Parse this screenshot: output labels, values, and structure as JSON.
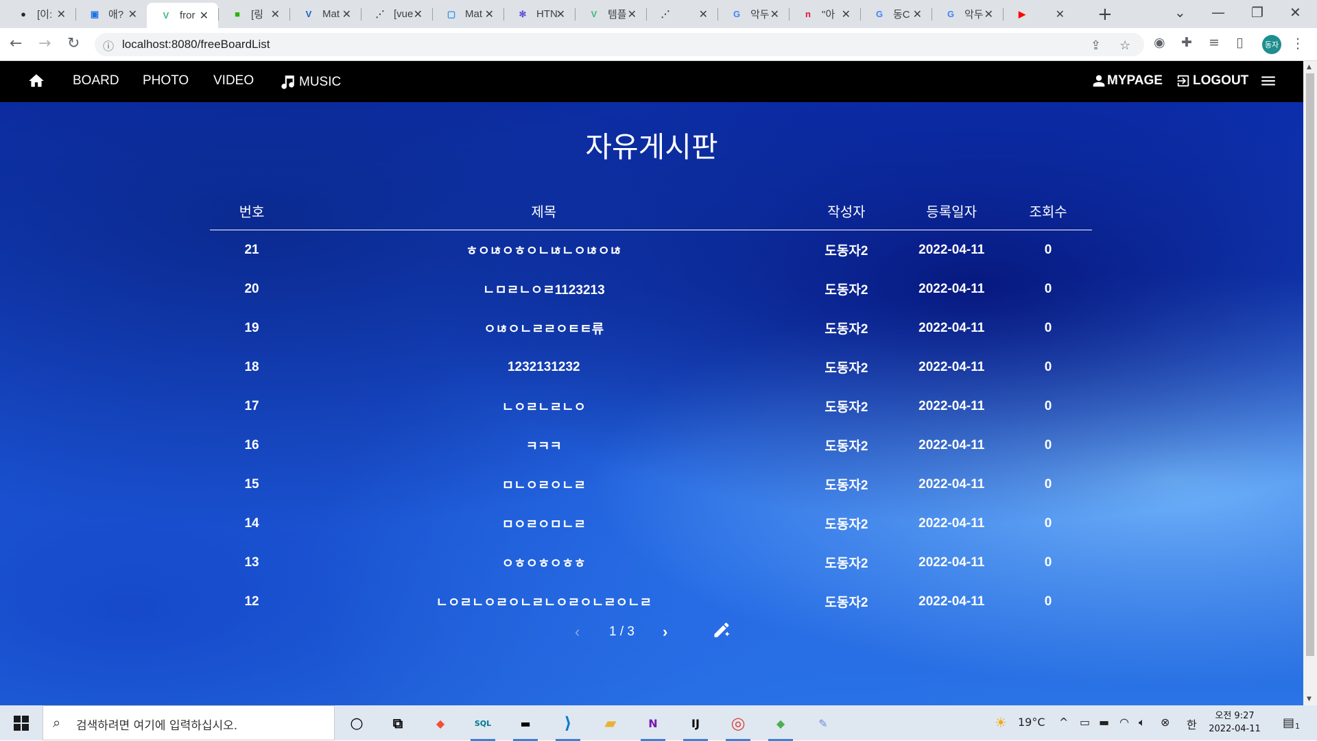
{
  "browser": {
    "tabs": [
      {
        "title": "[이:",
        "icon": "github-icon",
        "color": "#24292f"
      },
      {
        "title": "애?",
        "icon": "car-icon",
        "color": "#1a73e8"
      },
      {
        "title": "fror",
        "icon": "vue-icon",
        "color": "#41b883",
        "active": true
      },
      {
        "title": "[링",
        "icon": "green-square-icon",
        "color": "#2db400"
      },
      {
        "title": "Mat",
        "icon": "vuetify-icon",
        "color": "#1867c0"
      },
      {
        "title": "[vue",
        "icon": "dots-icon",
        "color": "#333333"
      },
      {
        "title": "Mat",
        "icon": "square-icon",
        "color": "#2196f3"
      },
      {
        "title": "HTN",
        "icon": "react-icon",
        "color": "#5b4fd6"
      },
      {
        "title": "템플",
        "icon": "vue-icon",
        "color": "#41b883"
      },
      {
        "title": "",
        "icon": "dots-icon",
        "color": "#333333"
      },
      {
        "title": "악두",
        "icon": "google-icon",
        "color": "#4285f4"
      },
      {
        "title": "\"아",
        "icon": "n-icon",
        "color": "#e8112d"
      },
      {
        "title": "동C",
        "icon": "google-icon",
        "color": "#4285f4"
      },
      {
        "title": "악두",
        "icon": "google-icon",
        "color": "#4285f4"
      },
      {
        "title": "",
        "icon": "youtube-icon",
        "color": "#ff0000"
      }
    ],
    "url": "localhost:8080/freeBoardList",
    "profile": "동자"
  },
  "navbar": {
    "home": "home",
    "board": "BOARD",
    "photo": "PHOTO",
    "video": "VIDEO",
    "music": "MUSIC",
    "mypage": "MYPAGE",
    "logout": "LOGOUT"
  },
  "board": {
    "title": "자유게시판",
    "headers": {
      "no": "번호",
      "title": "제목",
      "writer": "작성자",
      "date": "등록일자",
      "views": "조회수"
    },
    "rows": [
      {
        "no": "21",
        "title": "ㅎㅇㄶㅇㅎㅇㄴㄶㄴㅇㄶㅇㄶ",
        "writer": "도동자2",
        "date": "2022-04-11",
        "views": "0"
      },
      {
        "no": "20",
        "title": "ㄴㅁㄹㄴㅇㄹ1123213",
        "writer": "도동자2",
        "date": "2022-04-11",
        "views": "0"
      },
      {
        "no": "19",
        "title": "ㅇㄶㅇㄴㄹㄹㅇㅌㅌ류",
        "writer": "도동자2",
        "date": "2022-04-11",
        "views": "0"
      },
      {
        "no": "18",
        "title": "1232131232",
        "writer": "도동자2",
        "date": "2022-04-11",
        "views": "0"
      },
      {
        "no": "17",
        "title": "ㄴㅇㄹㄴㄹㄴㅇ",
        "writer": "도동자2",
        "date": "2022-04-11",
        "views": "0"
      },
      {
        "no": "16",
        "title": "ㅋㅋㅋ",
        "writer": "도동자2",
        "date": "2022-04-11",
        "views": "0"
      },
      {
        "no": "15",
        "title": "ㅁㄴㅇㄹㅇㄴㄹ",
        "writer": "도동자2",
        "date": "2022-04-11",
        "views": "0"
      },
      {
        "no": "14",
        "title": "ㅁㅇㄹㅇㅁㄴㄹ",
        "writer": "도동자2",
        "date": "2022-04-11",
        "views": "0"
      },
      {
        "no": "13",
        "title": "ㅇㅎㅇㅎㅇㅎㅎ",
        "writer": "도동자2",
        "date": "2022-04-11",
        "views": "0"
      },
      {
        "no": "12",
        "title": "ㄴㅇㄹㄴㅇㄹㅇㄴㄹㄴㅇㄹㅇㄴㄹㅇㄴㄹ",
        "writer": "도동자2",
        "date": "2022-04-11",
        "views": "0"
      }
    ],
    "pagination": "1 / 3"
  },
  "taskbar": {
    "search_placeholder": "검색하려면 여기에 입력하십시오.",
    "weather": "19°C",
    "ime": "한",
    "time": "오전 9:27",
    "date": "2022-04-11",
    "notifications": "1"
  }
}
